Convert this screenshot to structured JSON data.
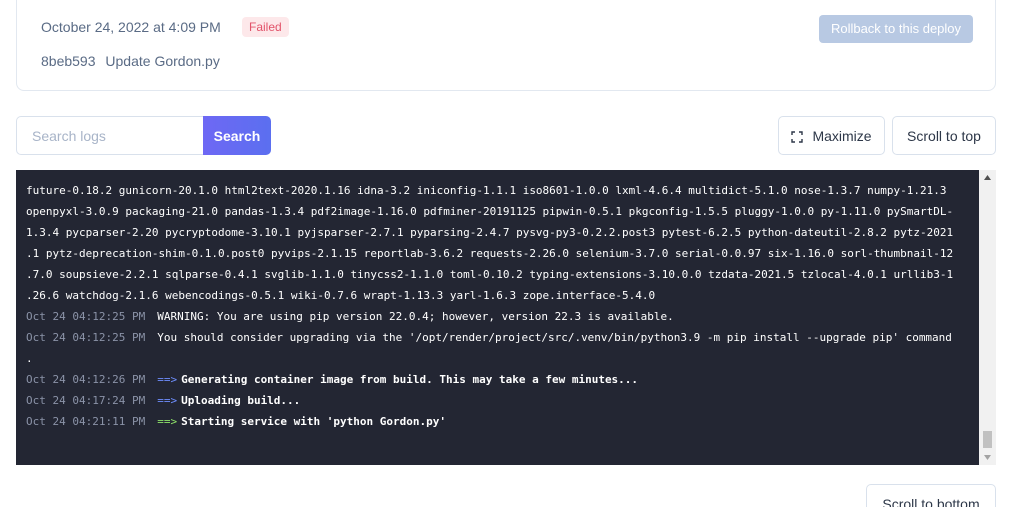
{
  "deploy": {
    "timestamp": "October 24, 2022 at 4:09 PM",
    "status": "Failed",
    "commit_hash": "8beb593",
    "commit_message": "Update Gordon.py",
    "rollback_label": "Rollback to this deploy"
  },
  "toolbar": {
    "search_placeholder": "Search logs",
    "search_label": "Search",
    "maximize_label": "Maximize",
    "scroll_top_label": "Scroll to top",
    "scroll_bottom_label": "Scroll to bottom"
  },
  "logs": {
    "wrapped": [
      "future-0.18.2 gunicorn-20.1.0 html2text-2020.1.16 idna-3.2 iniconfig-1.1.1 iso8601-1.0.0 lxml-4.6.4 multidict-5.1.0 nose-1.3.7 numpy-1.21.3",
      "openpyxl-3.0.9 packaging-21.0 pandas-1.3.4 pdf2image-1.16.0 pdfminer-20191125 pipwin-0.5.1 pkgconfig-1.5.5 pluggy-1.0.0 py-1.11.0 pySmartDL-",
      "1.3.4 pycparser-2.20 pycryptodome-3.10.1 pyjsparser-2.7.1 pyparsing-2.4.7 pysvg-py3-0.2.2.post3 pytest-6.2.5 python-dateutil-2.8.2 pytz-2021",
      ".1 pytz-deprecation-shim-0.1.0.post0 pyvips-2.1.15 reportlab-3.6.2 requests-2.26.0 selenium-3.7.0 serial-0.0.97 six-1.16.0 sorl-thumbnail-12",
      ".7.0 soupsieve-2.2.1 sqlparse-0.4.1 svglib-1.1.0 tinycss2-1.1.0 toml-0.10.2 typing-extensions-3.10.0.0 tzdata-2021.5 tzlocal-4.0.1 urllib3-1",
      ".26.6 watchdog-2.1.6 webencodings-0.5.1 wiki-0.7.6 wrapt-1.13.3 yarl-1.6.3 zope.interface-5.4.0"
    ],
    "entries": [
      {
        "time": "Oct 24 04:12:25 PM",
        "arrow": "",
        "text": "WARNING: You are using pip version 22.0.4; however, version 22.3 is available."
      },
      {
        "time": "Oct 24 04:12:25 PM",
        "arrow": "",
        "text": "You should consider upgrading via the '/opt/render/project/src/.venv/bin/python3.9 -m pip install --upgrade pip' command"
      },
      {
        "time": "",
        "arrow": "",
        "text": "."
      },
      {
        "time": "Oct 24 04:12:26 PM",
        "arrow": "==>",
        "text": "Generating container image from build. This may take a few minutes..."
      },
      {
        "time": "Oct 24 04:17:24 PM",
        "arrow": "==>",
        "text": "Uploading build..."
      },
      {
        "time": "Oct 24 04:21:11 PM",
        "arrow": "==>",
        "text": "Starting service with 'python Gordon.py'"
      }
    ]
  },
  "colors": {
    "status_failed": "#e2536a",
    "terminal_bg": "#232633",
    "arrow_info": "#6f8fff",
    "arrow_success": "#8fe36a",
    "primary": "#6e68f4"
  }
}
